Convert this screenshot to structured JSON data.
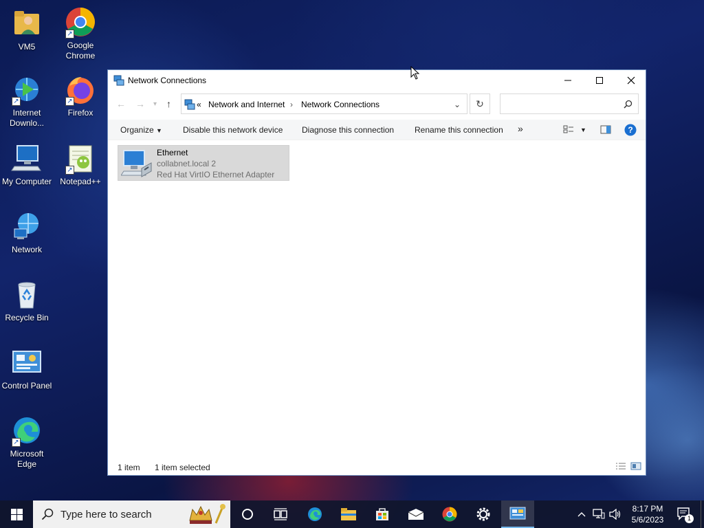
{
  "desktop": {
    "icons": [
      {
        "label": "VM5",
        "icon": "user-folder-icon"
      },
      {
        "label": "Google Chrome",
        "icon": "chrome-icon"
      },
      {
        "label": "Internet Downlo...",
        "icon": "internet-download-manager-icon"
      },
      {
        "label": "Firefox",
        "icon": "firefox-icon"
      },
      {
        "label": "My Computer",
        "icon": "computer-icon"
      },
      {
        "label": "Notepad++",
        "icon": "notepadpp-icon"
      },
      {
        "label": "Network",
        "icon": "network-icon"
      },
      {
        "label": "Recycle Bin",
        "icon": "recycle-bin-icon"
      },
      {
        "label": "Control Panel",
        "icon": "control-panel-icon"
      },
      {
        "label": "Microsoft Edge",
        "icon": "edge-icon"
      }
    ]
  },
  "window": {
    "title": "Network Connections",
    "address": {
      "overflow": "«",
      "crumbs": [
        "Network and Internet",
        "Network Connections"
      ]
    },
    "search": {
      "placeholder": ""
    },
    "toolbar": {
      "organize": "Organize",
      "disable": "Disable this network device",
      "diagnose": "Diagnose this connection",
      "rename": "Rename this connection",
      "more": "»"
    },
    "connections": [
      {
        "name": "Ethernet",
        "network": "collabnet.local 2",
        "adapter": "Red Hat VirtIO Ethernet Adapter"
      }
    ],
    "status": {
      "count": "1 item",
      "selected": "1 item selected"
    }
  },
  "taskbar": {
    "search_placeholder": "Type here to search",
    "time": "8:17 PM",
    "date": "5/6/2023",
    "notification_count": "1"
  },
  "colors": {
    "accent": "#0078d7",
    "help": "#1a6fd1"
  }
}
